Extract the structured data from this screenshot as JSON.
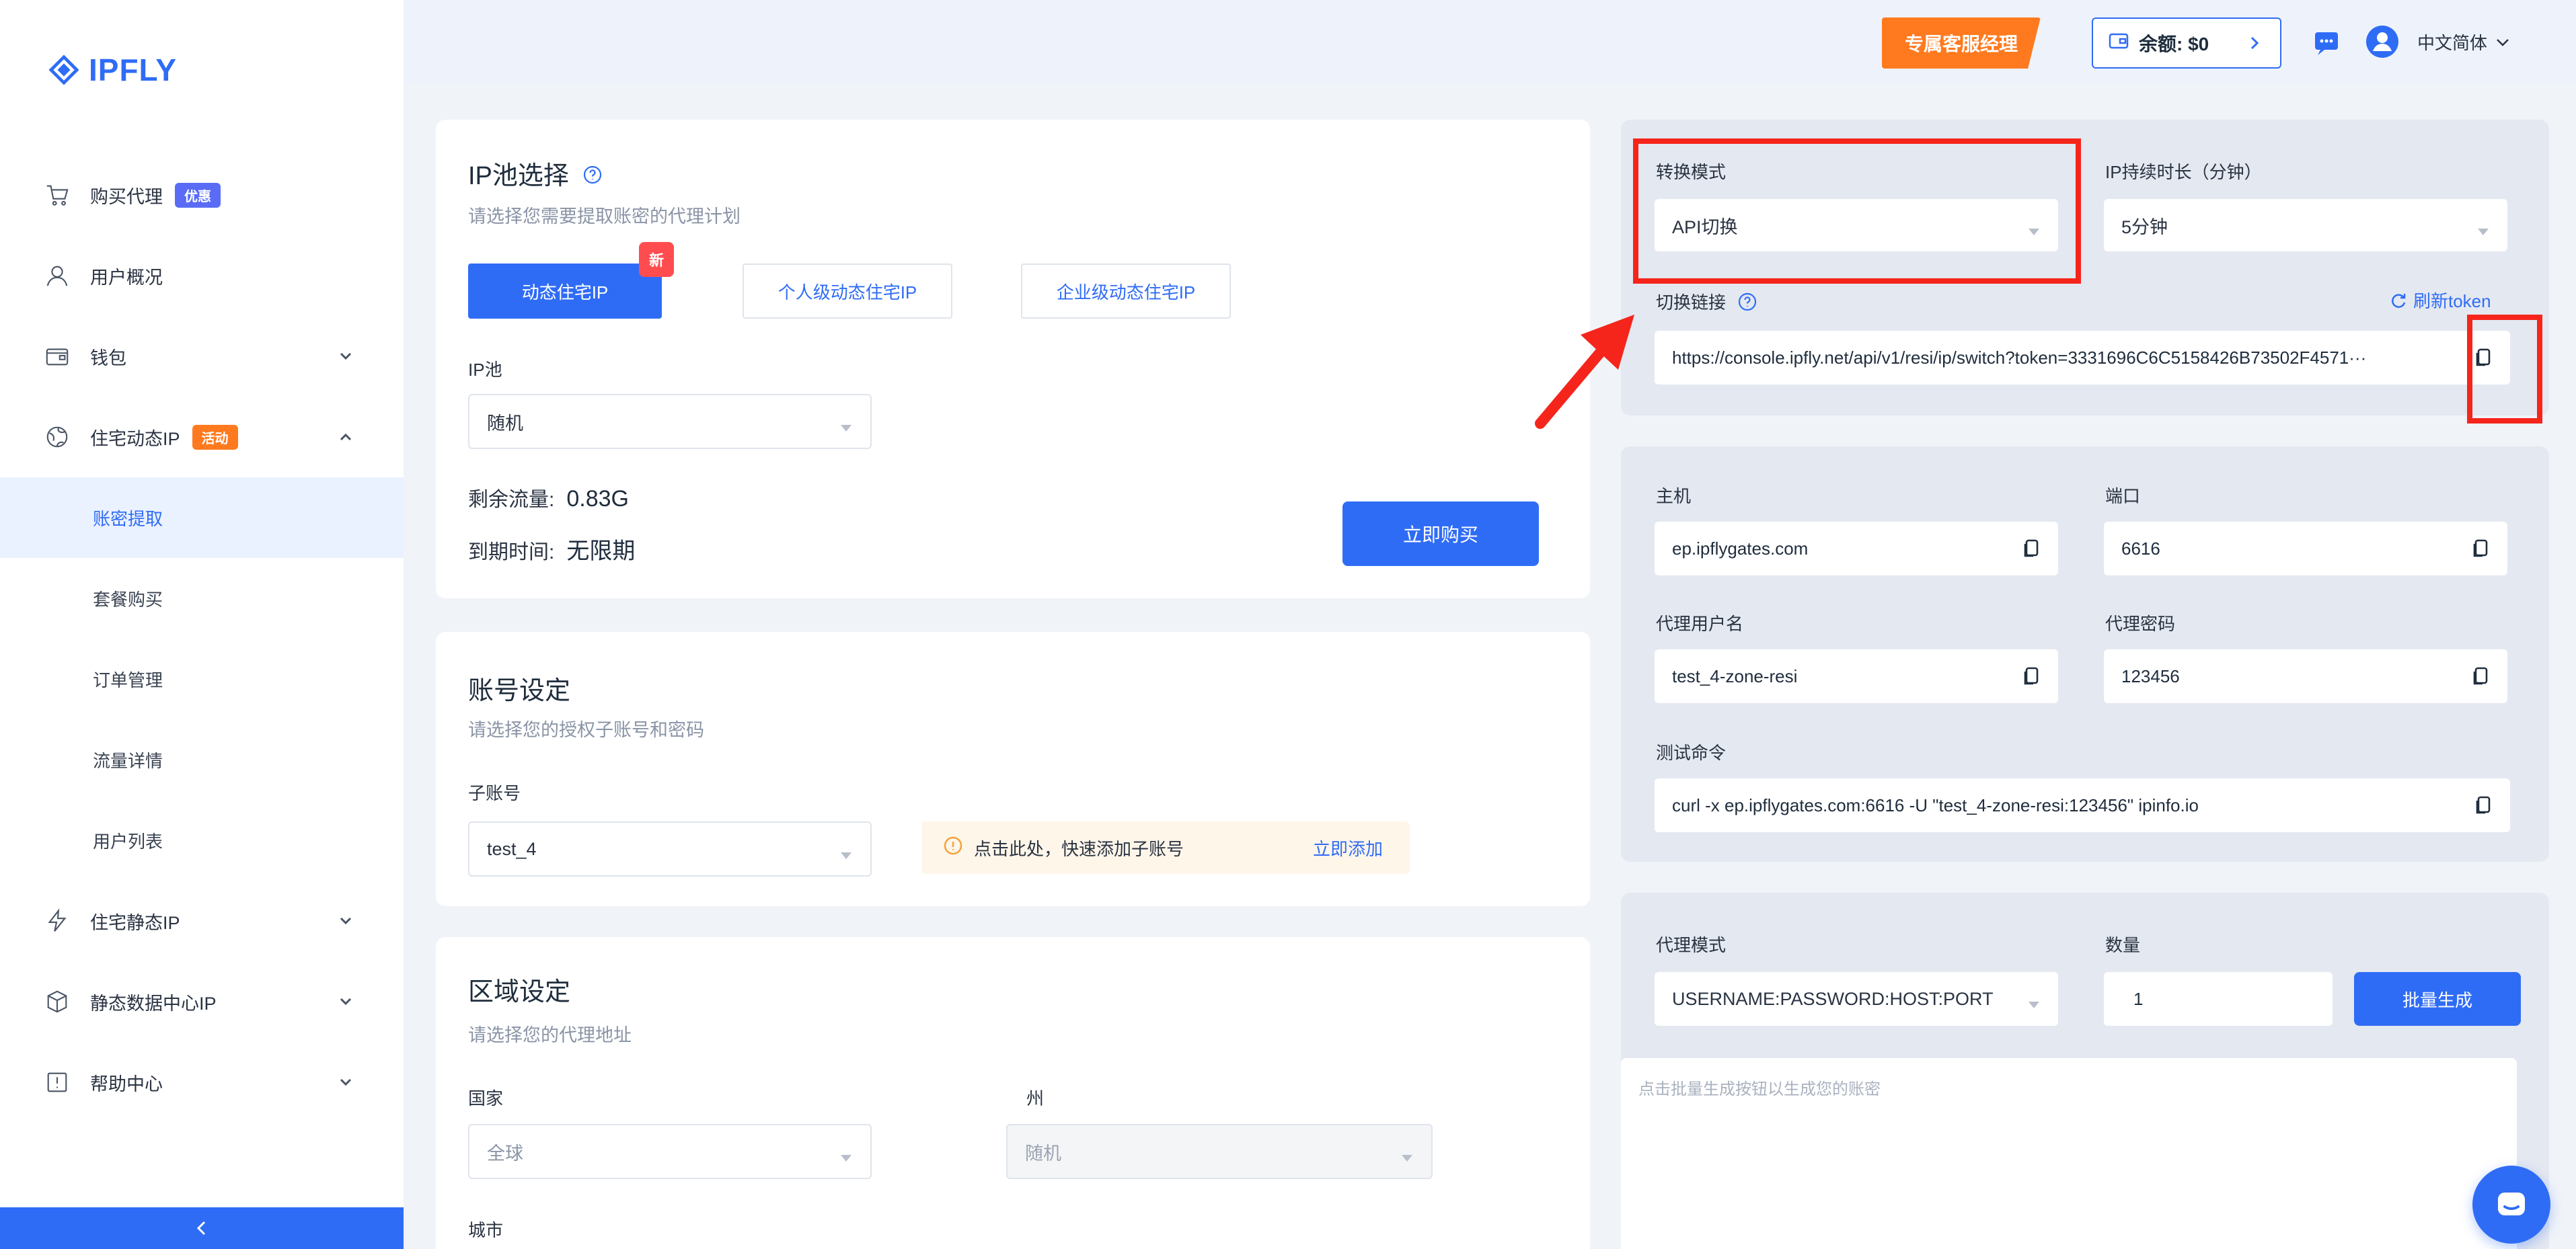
{
  "brand": {
    "name": "IPFLY",
    "accent": "#2f6cf6"
  },
  "topbar": {
    "vip_label": "专属客服经理",
    "balance_label": "余额:  $0",
    "language": "中文简体"
  },
  "sidebar": {
    "items": [
      {
        "label": "购买代理",
        "badge": "优惠"
      },
      {
        "label": "用户概况"
      },
      {
        "label": "钱包"
      },
      {
        "label": "住宅动态IP",
        "badge": "活动"
      },
      {
        "label": "住宅静态IP"
      },
      {
        "label": "静态数据中心IP"
      },
      {
        "label": "帮助中心"
      }
    ],
    "sub_items": [
      "账密提取",
      "套餐购买",
      "订单管理",
      "流量详情",
      "用户列表"
    ]
  },
  "pool_card": {
    "title": "IP池选择",
    "subtitle": "请选择您需要提取账密的代理计划",
    "tabs": [
      "动态住宅IP",
      "个人级动态住宅IP",
      "企业级动态住宅IP"
    ],
    "new_tag": "新",
    "pool_label": "IP池",
    "pool_value": "随机",
    "remaining_label": "剩余流量:",
    "remaining_value": "0.83G",
    "expire_label": "到期时间:",
    "expire_value": "无限期",
    "buy_button": "立即购买"
  },
  "account_card": {
    "title": "账号设定",
    "subtitle": "请选择您的授权子账号和密码",
    "sub_account_label": "子账号",
    "sub_account_value": "test_4",
    "notice_text": "点击此处，快速添加子账号",
    "notice_link": "立即添加"
  },
  "region_card": {
    "title": "区域设定",
    "subtitle": "请选择您的代理地址",
    "country_label": "国家",
    "country_value": "全球",
    "state_label": "州",
    "state_value": "随机",
    "city_label": "城市"
  },
  "switch_panel": {
    "mode_label": "转换模式",
    "mode_value": "API切换",
    "duration_label": "IP持续时长（分钟）",
    "duration_value": "5分钟",
    "link_label": "切换链接",
    "refresh_label": "刷新token",
    "link_value": "https://console.ipfly.net/api/v1/resi/ip/switch?token=3331696C6C5158426B73502F4571···"
  },
  "conn_panel": {
    "host_label": "主机",
    "host_value": "ep.ipflygates.com",
    "port_label": "端口",
    "port_value": "6616",
    "user_label": "代理用户名",
    "user_value": "test_4-zone-resi",
    "pass_label": "代理密码",
    "pass_value": "123456",
    "test_label": "测试命令",
    "test_value": "curl -x ep.ipflygates.com:6616 -U \"test_4-zone-resi:123456\" ipinfo.io"
  },
  "gen_panel": {
    "mode_label": "代理模式",
    "mode_value": "USERNAME:PASSWORD:HOST:PORT",
    "count_label": "数量",
    "count_value": "1",
    "generate_button": "批量生成",
    "output_placeholder": "点击批量生成按钮以生成您的账密"
  }
}
